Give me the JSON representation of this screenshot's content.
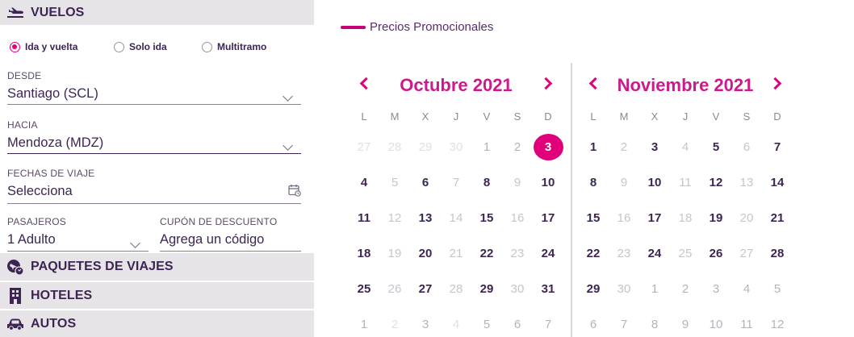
{
  "sections": {
    "vuelos": "VUELOS",
    "paquetes": "PAQUETES DE VIAJES",
    "hoteles": "HOTELES",
    "autos": "AUTOS"
  },
  "trip_type": {
    "options": [
      "Ida y vuelta",
      "Solo ida",
      "Multitramo"
    ],
    "selected": "Ida y vuelta"
  },
  "form": {
    "desde": {
      "label": "DESDE",
      "value": "Santiago (SCL)"
    },
    "hacia": {
      "label": "HACIA",
      "value": "Mendoza (MDZ)"
    },
    "fechas": {
      "label": "FECHAS DE VIAJE",
      "value": "Selecciona"
    },
    "pasajeros": {
      "label": "PASAJEROS",
      "value": "1 Adulto"
    },
    "cupon": {
      "label": "CUPÓN DE DESCUENTO",
      "placeholder": "Agrega un código"
    }
  },
  "legend": {
    "label": "Precios Promocionales",
    "color": "#c4007a"
  },
  "accent_color": "#e2007a",
  "weekdays": [
    "L",
    "M",
    "X",
    "J",
    "V",
    "S",
    "D"
  ],
  "calendars": [
    {
      "title": "Octubre 2021",
      "weeks": [
        [
          "27",
          "28",
          "29",
          "30",
          "1",
          "2",
          "3"
        ],
        [
          "4",
          "5",
          "6",
          "7",
          "8",
          "9",
          "10"
        ],
        [
          "11",
          "12",
          "13",
          "14",
          "15",
          "16",
          "17"
        ],
        [
          "18",
          "19",
          "20",
          "21",
          "22",
          "23",
          "24"
        ],
        [
          "25",
          "26",
          "27",
          "28",
          "29",
          "30",
          "31"
        ],
        [
          "1",
          "2",
          "3",
          "4",
          "5",
          "6",
          "7"
        ]
      ]
    },
    {
      "title": "Noviembre 2021",
      "weeks": [
        [
          "1",
          "2",
          "3",
          "4",
          "5",
          "6",
          "7"
        ],
        [
          "8",
          "9",
          "10",
          "11",
          "12",
          "13",
          "14"
        ],
        [
          "15",
          "16",
          "17",
          "18",
          "19",
          "20",
          "21"
        ],
        [
          "22",
          "23",
          "24",
          "25",
          "26",
          "27",
          "28"
        ],
        [
          "29",
          "30",
          "1",
          "2",
          "3",
          "4",
          "5"
        ],
        [
          "6",
          "7",
          "8",
          "9",
          "10",
          "11",
          "12"
        ]
      ]
    }
  ],
  "selected_day": "3"
}
